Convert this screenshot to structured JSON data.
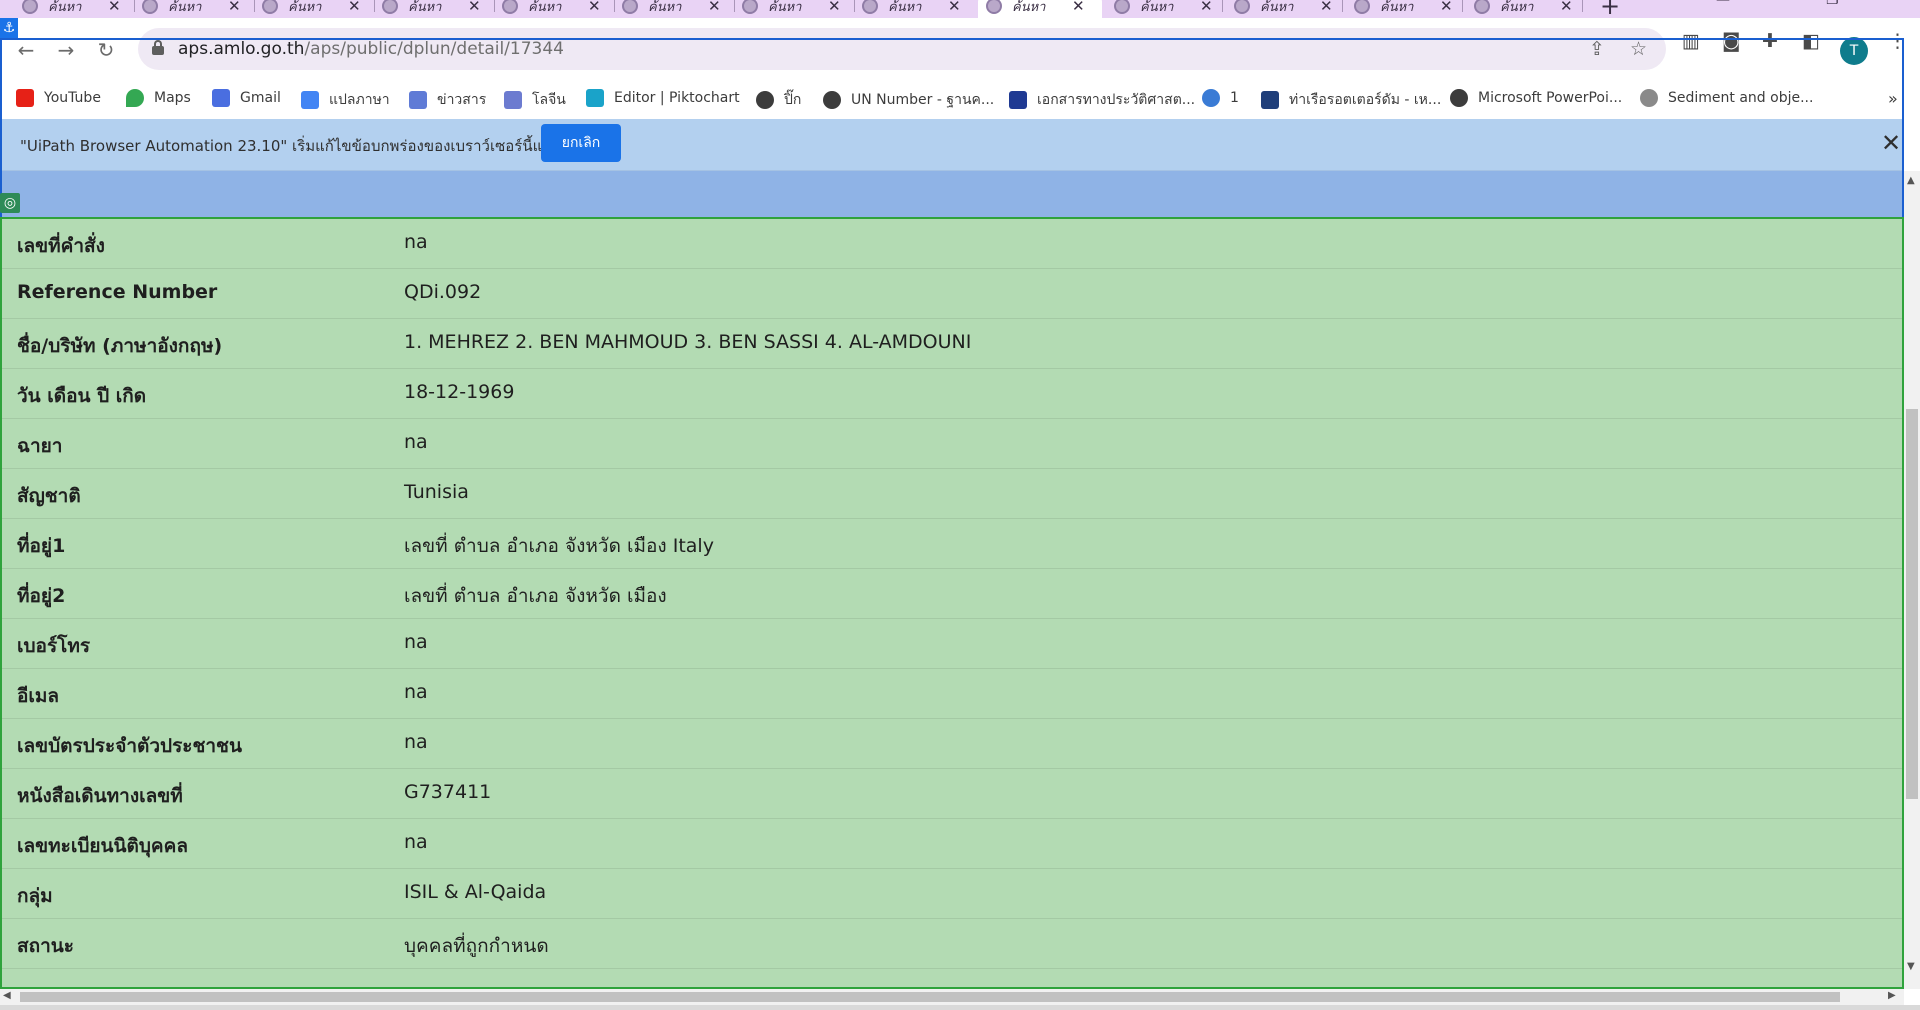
{
  "browser": {
    "tabs": [
      {
        "title": "ค้นหา"
      },
      {
        "title": "ค้นหา"
      },
      {
        "title": "ค้นหา"
      },
      {
        "title": "ค้นหา"
      },
      {
        "title": "ค้นหา"
      },
      {
        "title": "ค้นหา"
      },
      {
        "title": "ค้นหา"
      },
      {
        "title": "ค้นหา"
      },
      {
        "title": "ค้นหา",
        "active": true
      },
      {
        "title": "ค้นหา"
      },
      {
        "title": "ค้นหา"
      },
      {
        "title": "ค้นหา"
      },
      {
        "title": "ค้นหา"
      }
    ],
    "url_host": "aps.amlo.go.th",
    "url_path": "/aps/public/dplun/detail/17344",
    "profile_initial": "T"
  },
  "bookmarks": [
    {
      "label": "YouTube",
      "icon": "youtube-icon",
      "color": "#e62117"
    },
    {
      "label": "Maps",
      "icon": "maps-pin-icon",
      "color": "#34a853"
    },
    {
      "label": "Gmail",
      "icon": "gmail-icon",
      "color": "#4a6ee0"
    },
    {
      "label": "แปลภาษา",
      "icon": "translate-icon",
      "color": "#4285f4"
    },
    {
      "label": "ข่าวสาร",
      "icon": "news-icon",
      "color": "#5f7bd6"
    },
    {
      "label": "โลจีน",
      "icon": "chinese-flag-icon",
      "color": "#6c7bd0"
    },
    {
      "label": "Editor | Piktochart",
      "icon": "piktochart-icon",
      "color": "#1aa3c9"
    },
    {
      "label": "ปิ๊ก",
      "icon": "globe-icon",
      "color": "#3c3c3c"
    },
    {
      "label": "UN Number - ฐานค...",
      "icon": "globe-icon",
      "color": "#3c3c3c"
    },
    {
      "label": "เอกสารทางประวัติศาสต...",
      "icon": "document-icon",
      "color": "#1f3a93"
    },
    {
      "label": "1",
      "icon": "location-icon",
      "color": "#3a7bd5"
    },
    {
      "label": "ท่าเรือรอตเตอร์ดัม - เห...",
      "icon": "st-icon",
      "color": "#203f7a"
    },
    {
      "label": "Microsoft PowerPoi...",
      "icon": "globe-icon",
      "color": "#3c3c3c"
    },
    {
      "label": "Sediment and obje...",
      "icon": "figure-icon",
      "color": "#8a8a8a"
    }
  ],
  "infobar": {
    "message": "\"UiPath Browser Automation 23.10\" เริ่มแก้ไขข้อบกพร่องของเบราว์เซอร์นี้แล้ว",
    "cancel_label": "ยกเลิก"
  },
  "details": [
    {
      "label": "เลขที่คำสั่ง",
      "value": "na"
    },
    {
      "label": "Reference Number",
      "value": "QDi.092"
    },
    {
      "label": "ชื่อ/บริษัท (ภาษาอังกฤษ)",
      "value": "1. MEHREZ 2. BEN MAHMOUD 3. BEN SASSI 4. AL-AMDOUNI"
    },
    {
      "label": "วัน เดือน ปี เกิด",
      "value": "18-12-1969"
    },
    {
      "label": "ฉายา",
      "value": "na"
    },
    {
      "label": "สัญชาติ",
      "value": "Tunisia"
    },
    {
      "label": "ที่อยู่1",
      "value": "เลขที่ ตำบล อำเภอ จังหวัด เมือง Italy"
    },
    {
      "label": "ที่อยู่2",
      "value": "เลขที่ ตำบล อำเภอ จังหวัด เมือง"
    },
    {
      "label": "เบอร์โทร",
      "value": "na"
    },
    {
      "label": "อีเมล",
      "value": "na"
    },
    {
      "label": "เลขบัตรประจำตัวประชาชน",
      "value": "na"
    },
    {
      "label": "หนังสือเดินทางเลขที่",
      "value": "G737411"
    },
    {
      "label": "เลขทะเบียนนิติบุคคล",
      "value": "na"
    },
    {
      "label": "กลุ่ม",
      "value": "ISIL & Al-Qaida"
    },
    {
      "label": "สถานะ",
      "value": "บุคคลที่ถูกกำหนด"
    }
  ],
  "colors": {
    "content_bg": "#b3dbb3",
    "infobar_bg": "#b3d0ef",
    "accent": "#1a73e8",
    "tabstrip_bg": "#e9d3f5"
  }
}
